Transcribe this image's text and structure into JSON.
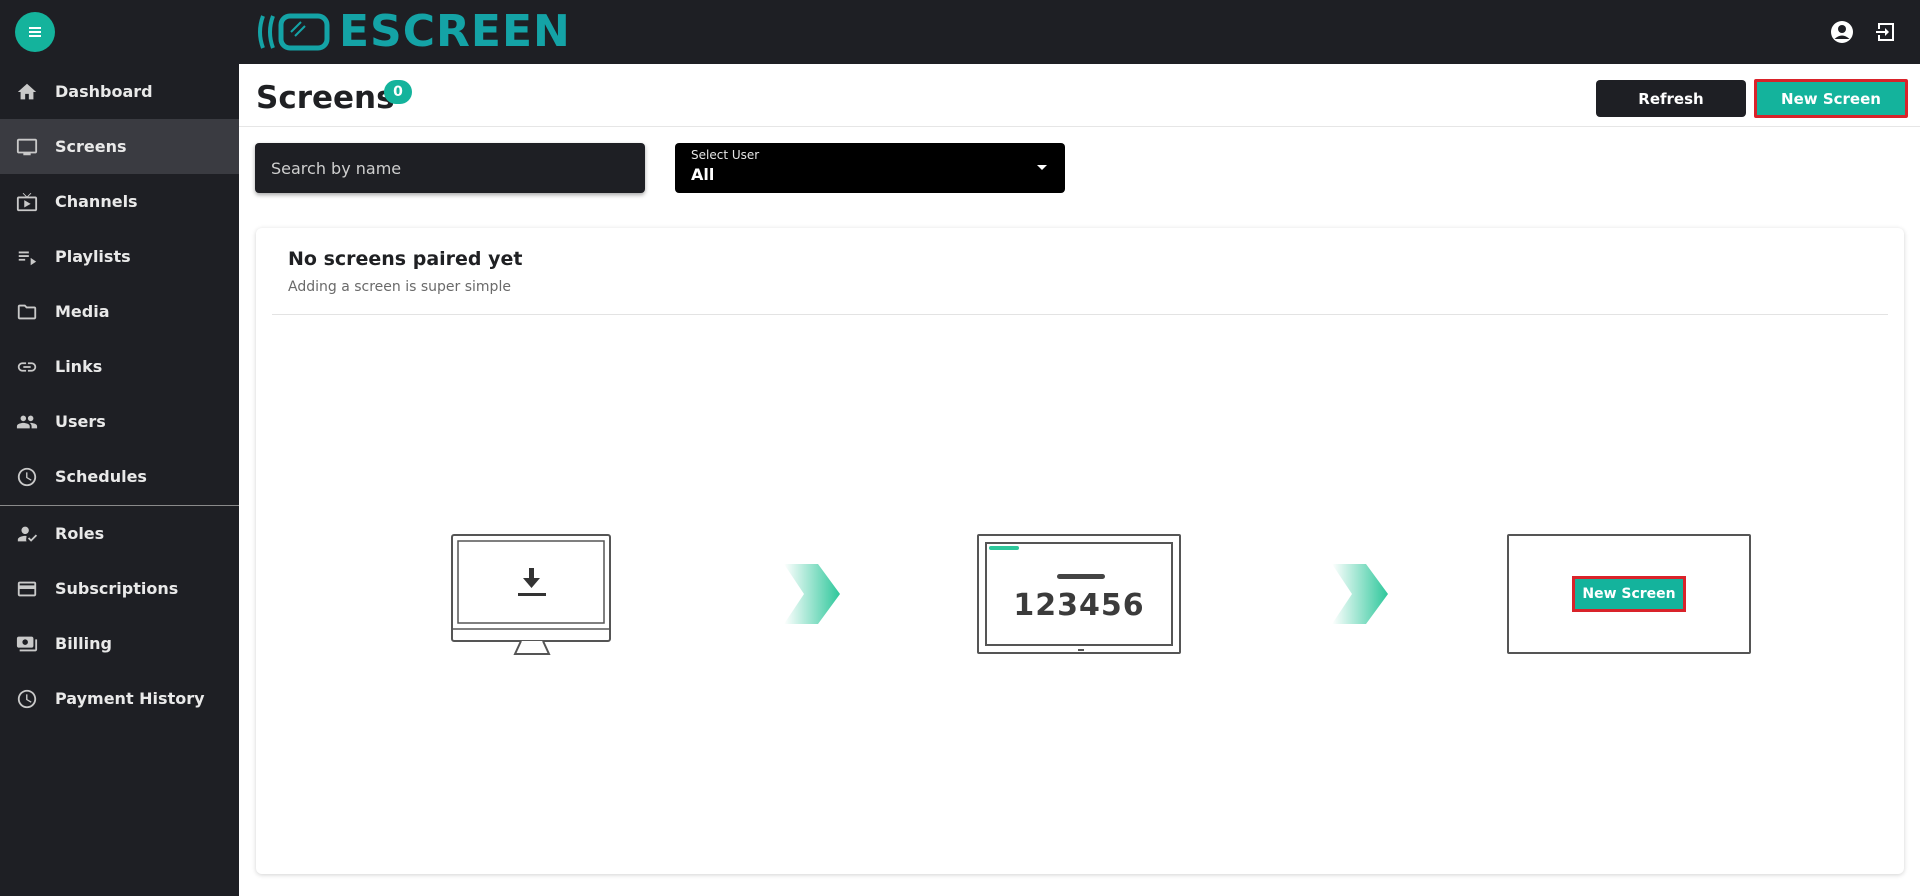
{
  "topbar": {
    "menu_icon": "hamburger-menu-icon",
    "logo_text": "ESCREEN",
    "account_icon": "account-circle-icon",
    "logout_icon": "logout-icon"
  },
  "sidebar": {
    "items": [
      {
        "label": "Dashboard",
        "icon": "home-icon"
      },
      {
        "label": "Screens",
        "icon": "monitor-icon",
        "active": true
      },
      {
        "label": "Channels",
        "icon": "tv-play-icon"
      },
      {
        "label": "Playlists",
        "icon": "playlist-icon"
      },
      {
        "label": "Media",
        "icon": "folder-icon"
      },
      {
        "label": "Links",
        "icon": "link-icon"
      },
      {
        "label": "Users",
        "icon": "users-icon"
      },
      {
        "label": "Schedules",
        "icon": "clock-icon"
      },
      {
        "label": "Roles",
        "icon": "user-check-icon"
      },
      {
        "label": "Subscriptions",
        "icon": "credit-card-icon"
      },
      {
        "label": "Billing",
        "icon": "cash-icon"
      },
      {
        "label": "Payment History",
        "icon": "clock-icon"
      }
    ]
  },
  "header": {
    "title": "Screens",
    "count": "0",
    "refresh_label": "Refresh",
    "new_screen_label": "New Screen"
  },
  "filters": {
    "search_placeholder": "Search by name",
    "select_label": "Select User",
    "select_value": "All"
  },
  "empty_state": {
    "title": "No screens paired yet",
    "subtitle": "Adding a screen is super simple",
    "pairing_code": "123456",
    "step3_button_label": "New Screen"
  },
  "colors": {
    "accent": "#14b39c",
    "dark": "#1e1f24",
    "highlight_border": "#d9232a"
  }
}
